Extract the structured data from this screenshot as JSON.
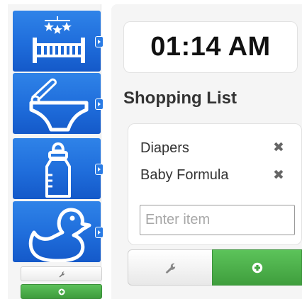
{
  "sidebar": {
    "categories": [
      {
        "name": "crib",
        "icon": "crib-icon"
      },
      {
        "name": "diaper",
        "icon": "diaper-icon"
      },
      {
        "name": "bottle",
        "icon": "bottle-icon"
      },
      {
        "name": "duck",
        "icon": "duck-icon"
      }
    ],
    "settings_icon": "wrench-icon",
    "add_icon": "plus-circle-icon"
  },
  "clock": {
    "time": "01:14 AM"
  },
  "shopping_list": {
    "title": "Shopping List",
    "items": [
      {
        "label": "Diapers",
        "remove_icon": "close-icon"
      },
      {
        "label": "Baby Formula",
        "remove_icon": "close-icon"
      }
    ],
    "input": {
      "placeholder": "Enter item",
      "value": ""
    },
    "settings_icon": "wrench-icon",
    "add_icon": "plus-circle-icon",
    "remove_glyph": "✖"
  },
  "colors": {
    "tile_blue": "#1f6ddb",
    "add_green": "#4aab48",
    "panel_bg": "#f5f5f5"
  }
}
